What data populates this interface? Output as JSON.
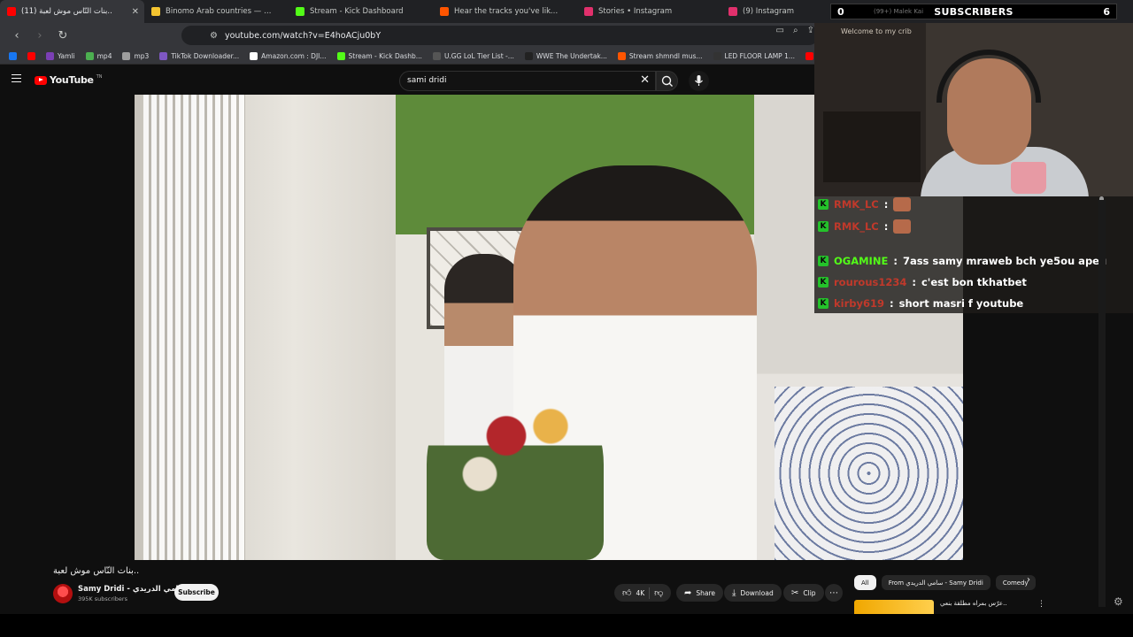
{
  "browser": {
    "tabs": [
      {
        "label": "(11) بنات النّاس موش لعبة..",
        "active": true,
        "favicon_color": "#ff0000"
      },
      {
        "label": "Binomo Arab countries — official site",
        "active": false,
        "favicon_color": "#f4c430"
      },
      {
        "label": "Stream - Kick Dashboard",
        "active": false,
        "favicon_color": "#53fc18"
      },
      {
        "label": "Hear the tracks you've liked: on",
        "active": false,
        "favicon_color": "#ff5500"
      },
      {
        "label": "Stories • Instagram",
        "active": false,
        "favicon_color": "#e1306c"
      },
      {
        "label": "(9) Instagram",
        "active": false,
        "favicon_color": "#e1306c"
      }
    ],
    "url": "youtube.com/watch?v=E4hoACju0bY",
    "bookmarks": [
      {
        "label": "",
        "color": "#1877f2"
      },
      {
        "label": "",
        "color": "#ff0000"
      },
      {
        "label": "Yamli",
        "color": "#7b3fb5"
      },
      {
        "label": "mp4",
        "color": "#4caf50"
      },
      {
        "label": "mp3",
        "color": "#9e9e9e"
      },
      {
        "label": "TikTok Downloader...",
        "color": "#7e57c2"
      },
      {
        "label": "Amazon.com : DJI...",
        "color": "#ffffff"
      },
      {
        "label": "Stream - Kick Dashb...",
        "color": "#53fc18"
      },
      {
        "label": "U.GG LoL Tier List -...",
        "color": "#555555"
      },
      {
        "label": "WWE The Undertak...",
        "color": "#222222"
      },
      {
        "label": "Stream shmndl mus...",
        "color": "#ff5500"
      },
      {
        "label": "LED FLOOR LAMP 1...",
        "color": "#333333"
      },
      {
        "label": "(6",
        "color": "#ff0000"
      }
    ]
  },
  "youtube": {
    "logo_text": "YouTube",
    "logo_country": "TN",
    "search_query": "sami dridi",
    "video_title": "بنات النّاس موش لعبة..",
    "channel_name": "Samy Dridi - سامي الدريدي",
    "subscriber_count": "395K subscribers",
    "subscribe_label": "Subscribe",
    "likes": "4K",
    "share_label": "Share",
    "download_label": "Download",
    "clip_label": "Clip",
    "chips": [
      "All",
      "From سامي الدريدي - Samy Dridi",
      "Comedy"
    ],
    "recommendation_title": "عرّس بمراه مطلقة بنعي.."
  },
  "overlay": {
    "sub_goal_left": "0",
    "sub_goal_label": "SUBSCRIBERS",
    "sub_goal_right": "6",
    "sub_goal_ghost": "(99+) Malek Kai",
    "cam_sign": "Welcome to my crib",
    "chat": [
      {
        "user": "RMK_LC",
        "message": "",
        "color": "#c0392b",
        "emote": true
      },
      {
        "user": "RMK_LC",
        "message": "",
        "color": "#c0392b",
        "emote": true
      },
      {
        "user": "OGAMINE",
        "message": "7ass samy mraweb bch ye5ou apeu",
        "color": "#53fc18",
        "emote": false
      },
      {
        "user": "rourous1234",
        "message": "c'est bon tkhatbet",
        "color": "#c0392b",
        "emote": false
      },
      {
        "user": "kirby619",
        "message": "short masri f youtube",
        "color": "#c0392b",
        "emote": false
      }
    ]
  }
}
